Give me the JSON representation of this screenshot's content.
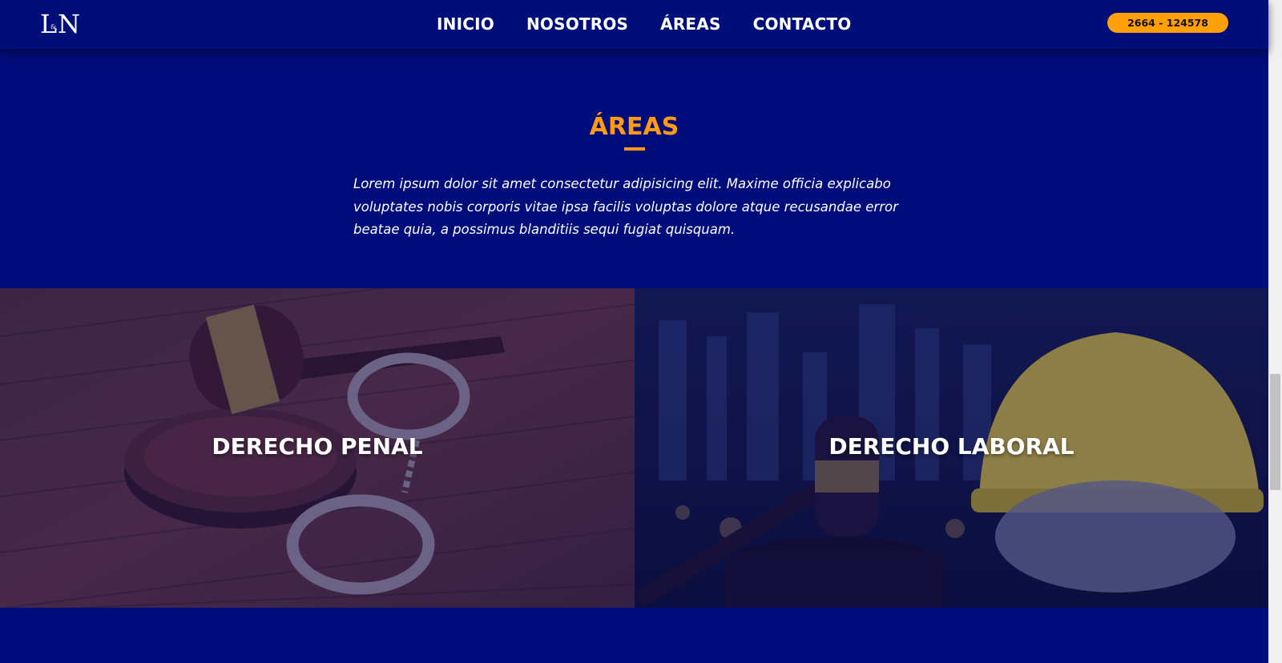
{
  "header": {
    "logo_text": "L&N",
    "nav": [
      "INICIO",
      "NOSOTROS",
      "ÁREAS",
      "CONTACTO"
    ],
    "phone": "2664 - 124578"
  },
  "areas": {
    "title": "ÁREAS",
    "intro": "Lorem ipsum dolor sit amet consectetur adipisicing elit. Maxime officia explicabo voluptates nobis corporis vitae ipsa facilis voluptas dolore atque recusandae error beatae quia, a possimus blanditiis sequi fugiat quisquam.",
    "cards": [
      {
        "title": "DERECHO PENAL"
      },
      {
        "title": "DERECHO LABORAL"
      }
    ]
  },
  "colors": {
    "background": "#000d7a",
    "accent": "#ff9a16",
    "text": "#ffffff"
  }
}
